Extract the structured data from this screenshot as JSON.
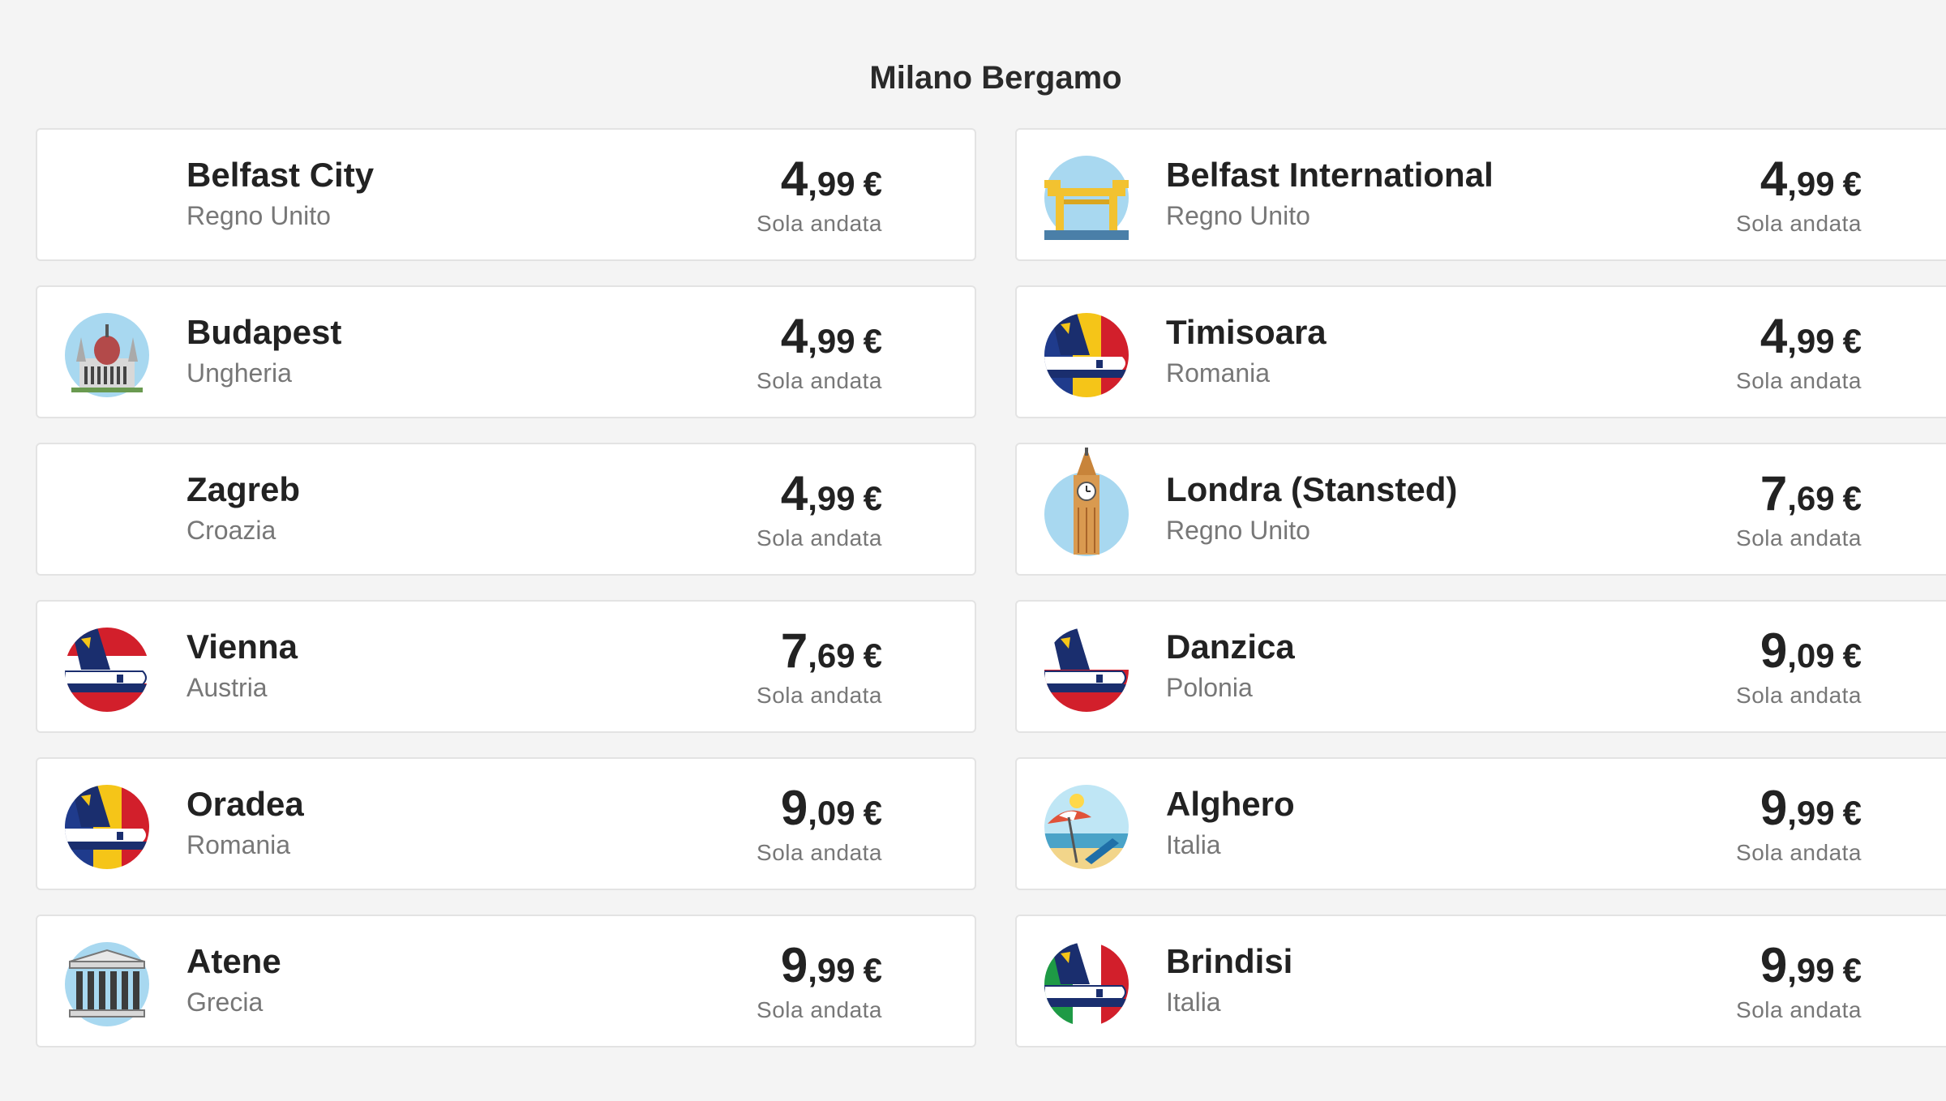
{
  "section_title": "Milano Bergamo",
  "fares": [
    {
      "city": "Belfast City",
      "country": "Regno Unito",
      "price_int": "4",
      "price_dec": ",99",
      "currency": "€",
      "fare_type": "Sola andata",
      "icon": "none"
    },
    {
      "city": "Belfast International",
      "country": "Regno Unito",
      "price_int": "4",
      "price_dec": ",99",
      "currency": "€",
      "fare_type": "Sola andata",
      "icon": "belfast-cranes-icon"
    },
    {
      "city": "Budapest",
      "country": "Ungheria",
      "price_int": "4",
      "price_dec": ",99",
      "currency": "€",
      "fare_type": "Sola andata",
      "icon": "budapest-parliament-icon"
    },
    {
      "city": "Timisoara",
      "country": "Romania",
      "price_int": "4",
      "price_dec": ",99",
      "currency": "€",
      "fare_type": "Sola andata",
      "icon": "ryanair-plane-romania-icon"
    },
    {
      "city": "Zagreb",
      "country": "Croazia",
      "price_int": "4",
      "price_dec": ",99",
      "currency": "€",
      "fare_type": "Sola andata",
      "icon": "none"
    },
    {
      "city": "Londra (Stansted)",
      "country": "Regno Unito",
      "price_int": "7",
      "price_dec": ",69",
      "currency": "€",
      "fare_type": "Sola andata",
      "icon": "big-ben-icon"
    },
    {
      "city": "Vienna",
      "country": "Austria",
      "price_int": "7",
      "price_dec": ",69",
      "currency": "€",
      "fare_type": "Sola andata",
      "icon": "ryanair-plane-austria-icon"
    },
    {
      "city": "Danzica",
      "country": "Polonia",
      "price_int": "9",
      "price_dec": ",09",
      "currency": "€",
      "fare_type": "Sola andata",
      "icon": "ryanair-plane-poland-icon"
    },
    {
      "city": "Oradea",
      "country": "Romania",
      "price_int": "9",
      "price_dec": ",09",
      "currency": "€",
      "fare_type": "Sola andata",
      "icon": "ryanair-plane-romania-icon"
    },
    {
      "city": "Alghero",
      "country": "Italia",
      "price_int": "9",
      "price_dec": ",99",
      "currency": "€",
      "fare_type": "Sola andata",
      "icon": "beach-umbrella-icon"
    },
    {
      "city": "Atene",
      "country": "Grecia",
      "price_int": "9",
      "price_dec": ",99",
      "currency": "€",
      "fare_type": "Sola andata",
      "icon": "greek-temple-icon"
    },
    {
      "city": "Brindisi",
      "country": "Italia",
      "price_int": "9",
      "price_dec": ",99",
      "currency": "€",
      "fare_type": "Sola andata",
      "icon": "ryanair-plane-italy-icon"
    }
  ]
}
